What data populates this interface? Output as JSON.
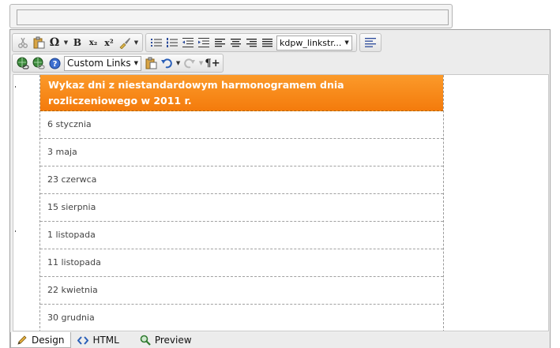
{
  "title_field": {
    "value": ""
  },
  "toolbar": {
    "row1": {
      "group1": [
        "cut-icon",
        "paste-icon",
        "insert-symbol-icon",
        "bold-icon",
        "subscript-icon",
        "superscript-icon",
        "format-brush-icon"
      ],
      "bold_label": "B",
      "symbol_label": "Ω",
      "subscript_label": "x₂",
      "superscript_label": "x²",
      "css_class_select": "kdpw_linkstr..."
    },
    "row2": {
      "custom_links_select": "Custom Links",
      "paragraph_label": "¶+"
    }
  },
  "table": {
    "header": "Wykaz dni z niestandardowym harmonogramem dnia rozliczeniowego w 2011 r.",
    "rows": [
      "6 stycznia",
      "3 maja",
      "23 czerwca",
      "15 sierpnia",
      "1 listopada",
      "11 listopada",
      "22 kwietnia",
      "30 grudnia"
    ]
  },
  "modes": {
    "design": "Design",
    "html": "HTML",
    "preview": "Preview"
  },
  "colors": {
    "header_orange": "#f7870f",
    "toolbar_bg": "#ececec"
  }
}
